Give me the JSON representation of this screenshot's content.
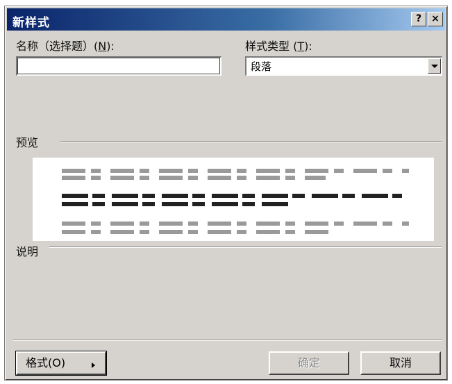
{
  "window": {
    "title": "新样式",
    "help_label": "?",
    "close_label": "×"
  },
  "name_field": {
    "label": "名称（选择题）(",
    "accel": "N",
    "label_end": "):",
    "value": ""
  },
  "style_type": {
    "label": "样式类型 (",
    "accel": "T",
    "label_end": "):",
    "value": "段落"
  },
  "preview": {
    "label": "预览"
  },
  "description": {
    "label": "说明"
  },
  "buttons": {
    "format_label": "格式(O)",
    "ok_label": "确定",
    "cancel_label": "取消"
  },
  "colors": {
    "titlebar_start": "#0a246a",
    "titlebar_end": "#a6caf0",
    "dialog_bg": "#d6d3ce"
  }
}
